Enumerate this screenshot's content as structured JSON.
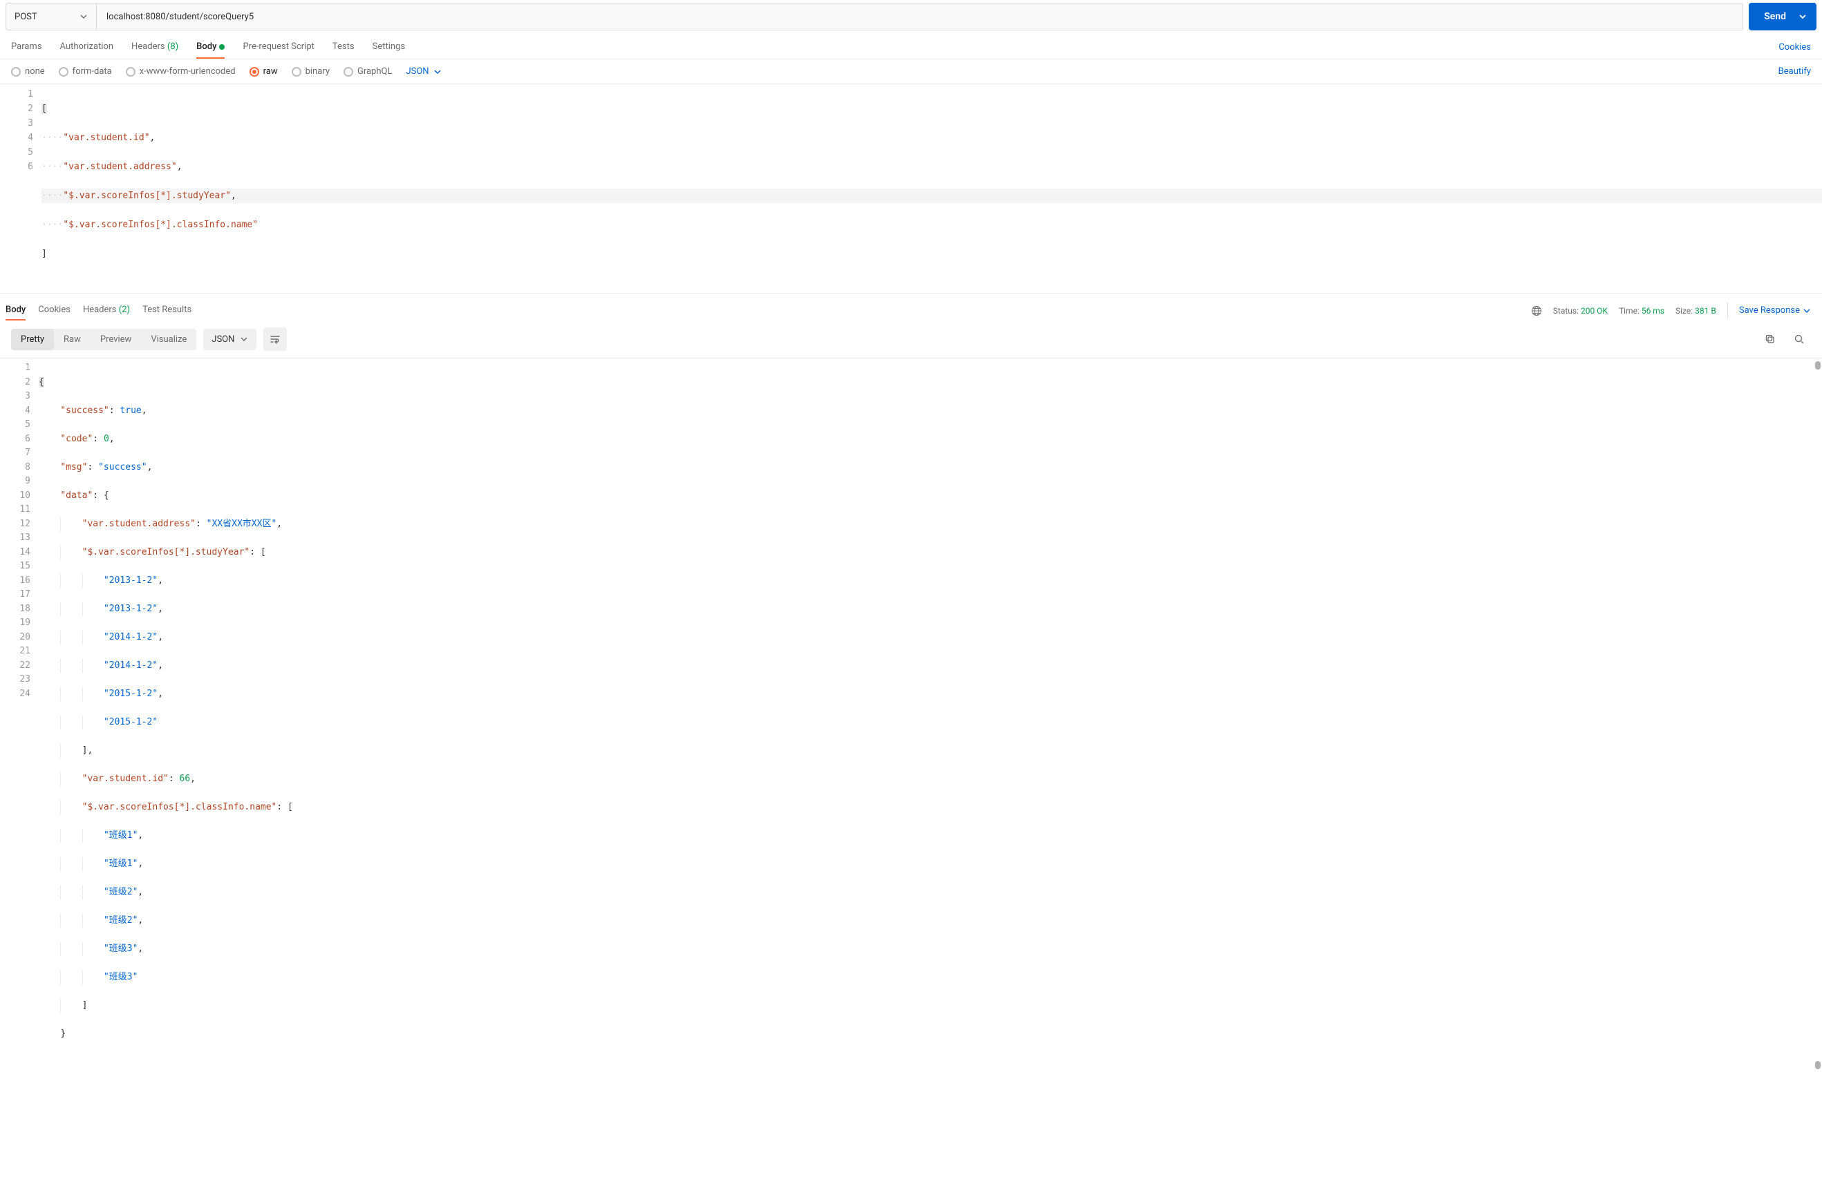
{
  "request": {
    "method": "POST",
    "url": "localhost:8080/student/scoreQuery5",
    "send_label": "Send"
  },
  "req_tabs": {
    "params": "Params",
    "authorization": "Authorization",
    "headers_label": "Headers",
    "headers_count": "(8)",
    "body": "Body",
    "prerequest": "Pre-request Script",
    "tests": "Tests",
    "settings": "Settings",
    "cookies": "Cookies"
  },
  "body_types": {
    "none": "none",
    "form_data": "form-data",
    "urlencoded": "x-www-form-urlencoded",
    "raw": "raw",
    "binary": "binary",
    "graphql": "GraphQL",
    "format": "JSON",
    "beautify": "Beautify"
  },
  "req_body_lines": [
    "1",
    "2",
    "3",
    "4",
    "5",
    "6"
  ],
  "req_body": {
    "l1": "[",
    "l2a": "\"var.student.id\"",
    "l2b": ",",
    "l3a": "\"var.student.address\"",
    "l3b": ",",
    "l4a": "\"$.var.scoreInfos[*].studyYear\"",
    "l4b": ",",
    "l5a": "\"$.var.scoreInfos[*].classInfo.name\"",
    "l6": "]"
  },
  "resp_tabs": {
    "body": "Body",
    "cookies": "Cookies",
    "headers_label": "Headers",
    "headers_count": "(2)",
    "test_results": "Test Results"
  },
  "resp_meta": {
    "status_label": "Status:",
    "status_value": "200 OK",
    "time_label": "Time:",
    "time_value": "56 ms",
    "size_label": "Size:",
    "size_value": "381 B",
    "save": "Save Response"
  },
  "resp_views": {
    "pretty": "Pretty",
    "raw": "Raw",
    "preview": "Preview",
    "visualize": "Visualize",
    "format": "JSON"
  },
  "resp_lines": [
    "1",
    "2",
    "3",
    "4",
    "5",
    "6",
    "7",
    "8",
    "9",
    "10",
    "11",
    "12",
    "13",
    "14",
    "15",
    "16",
    "17",
    "18",
    "19",
    "20",
    "21",
    "22",
    "23",
    "24"
  ],
  "resp": {
    "k_success": "\"success\"",
    "v_true": "true",
    "k_code": "\"code\"",
    "v_zero": "0",
    "k_msg": "\"msg\"",
    "v_msg": "\"success\"",
    "k_data": "\"data\"",
    "k_addr": "\"var.student.address\"",
    "v_addr": "\"XX省XX市XX区\"",
    "k_year": "\"$.var.scoreInfos[*].studyYear\"",
    "y1": "\"2013-1-2\"",
    "y2": "\"2013-1-2\"",
    "y3": "\"2014-1-2\"",
    "y4": "\"2014-1-2\"",
    "y5": "\"2015-1-2\"",
    "y6": "\"2015-1-2\"",
    "k_id": "\"var.student.id\"",
    "v_id": "66",
    "k_class": "\"$.var.scoreInfos[*].classInfo.name\"",
    "c1": "\"班级1\"",
    "c2": "\"班级1\"",
    "c3": "\"班级2\"",
    "c4": "\"班级2\"",
    "c5": "\"班级3\"",
    "c6": "\"班级3\""
  }
}
